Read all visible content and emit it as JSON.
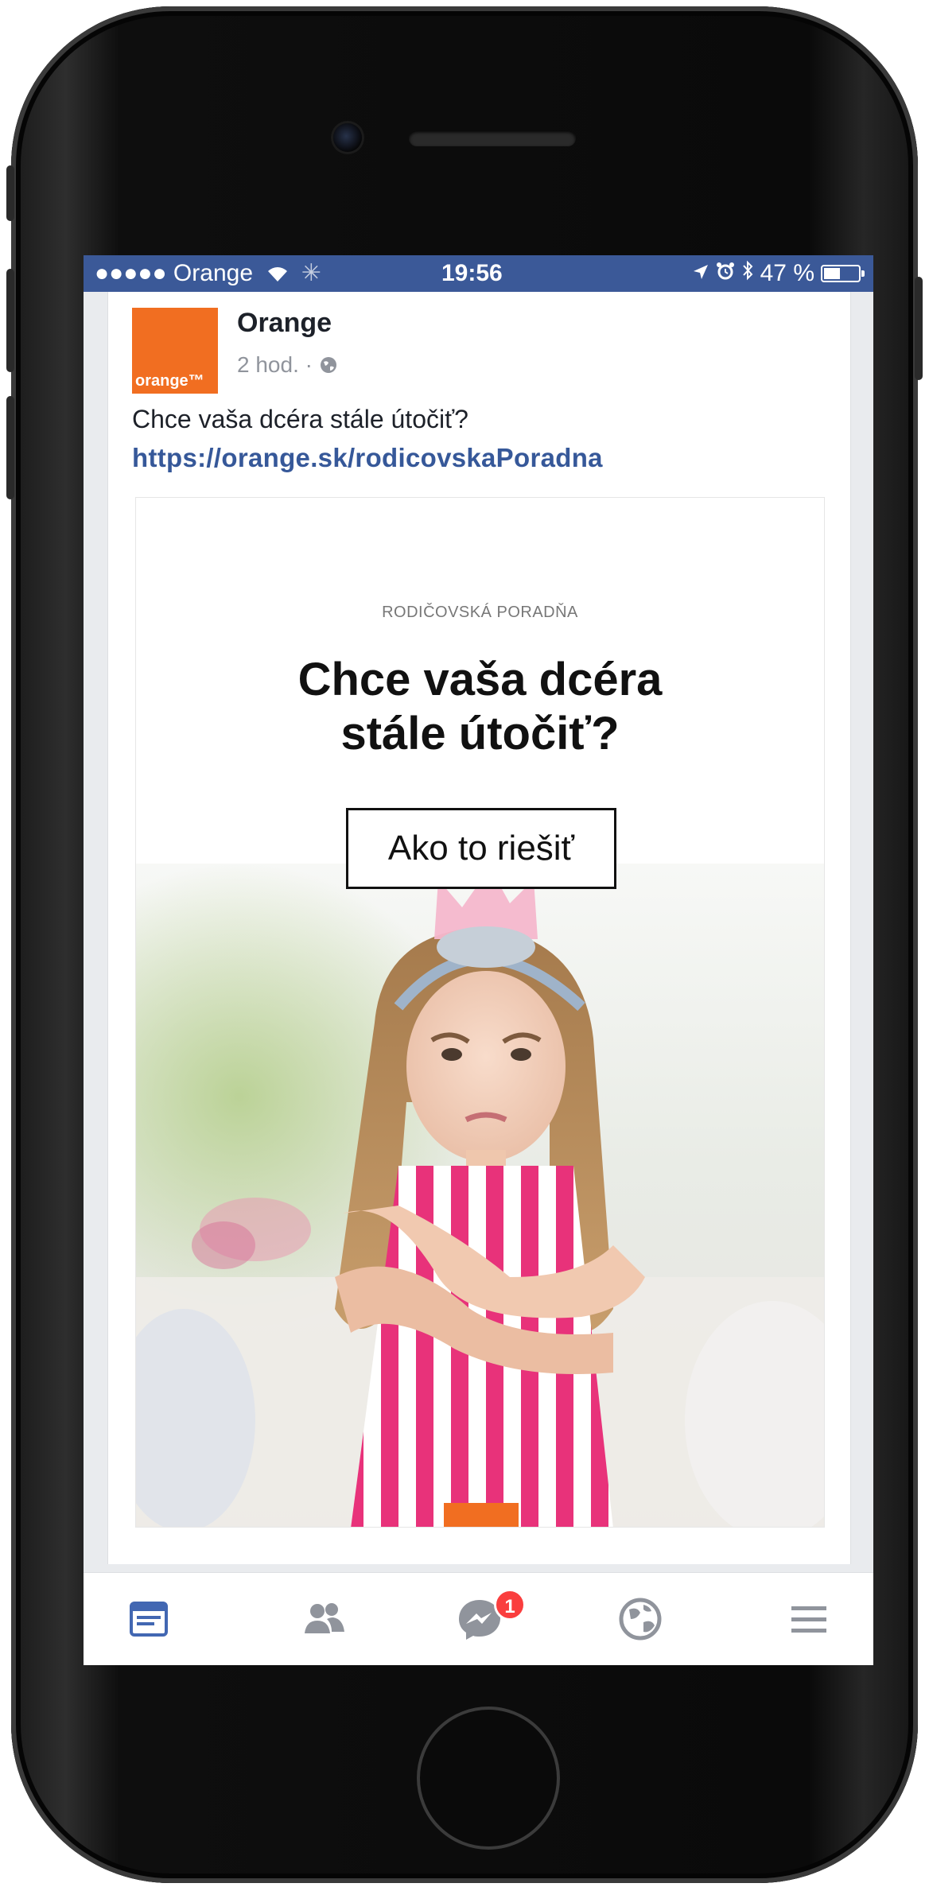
{
  "status_bar": {
    "signal_and_carrier": "●●●●● Orange",
    "time": "19:56",
    "battery_percent": "47 %",
    "battery_level": 0.47
  },
  "post": {
    "page_name": "Orange",
    "logo_text": "orange™",
    "time_ago": "2 hod. ·",
    "text": "Chce vaša dcéra stále útočiť?",
    "link": "https://orange.sk/rodicovskaPoradna"
  },
  "ad": {
    "eyebrow": "RODIČOVSKÁ PORADŇA",
    "headline_line1": "Chce vaša dcéra",
    "headline_line2": "stále útočiť?",
    "cta": "Ako to riešiť"
  },
  "tabbar": {
    "items": [
      {
        "icon": "news-feed-icon",
        "active": true
      },
      {
        "icon": "friends-icon",
        "active": false
      },
      {
        "icon": "messenger-icon",
        "active": false,
        "badge": "1"
      },
      {
        "icon": "globe-icon",
        "active": false
      },
      {
        "icon": "menu-icon",
        "active": false
      }
    ]
  },
  "colors": {
    "status_bar": "#3b5998",
    "brand_orange": "#f16e21",
    "link": "#365899",
    "active_tab": "#4267b2",
    "inactive_tab": "#90949c",
    "badge": "#fa3e3e"
  }
}
